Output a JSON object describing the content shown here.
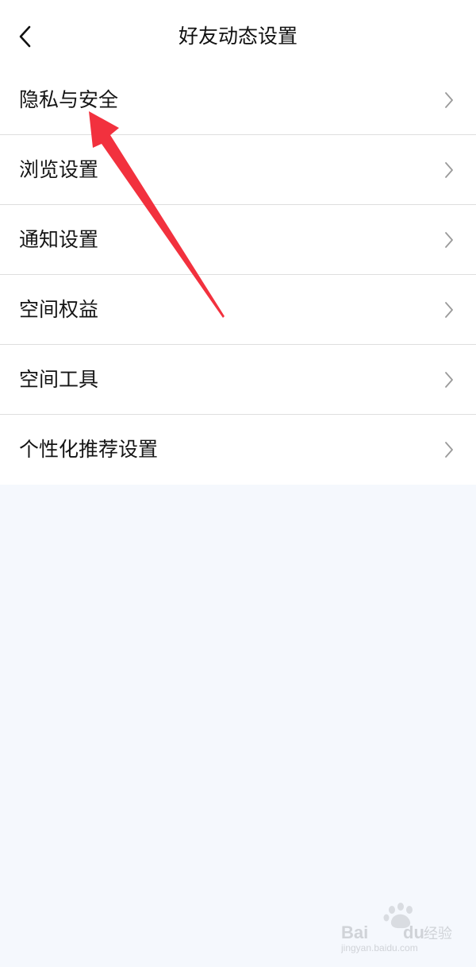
{
  "header": {
    "title": "好友动态设置",
    "back_icon": "chevron-left-icon"
  },
  "menu": {
    "items": [
      {
        "label": "隐私与安全",
        "icon": "chevron-right-icon"
      },
      {
        "label": "浏览设置",
        "icon": "chevron-right-icon"
      },
      {
        "label": "通知设置",
        "icon": "chevron-right-icon"
      },
      {
        "label": "空间权益",
        "icon": "chevron-right-icon"
      },
      {
        "label": "空间工具",
        "icon": "chevron-right-icon"
      },
      {
        "label": "个性化推荐设置",
        "icon": "chevron-right-icon"
      }
    ]
  },
  "annotation": {
    "color": "#f2313e"
  },
  "watermark": {
    "brand_text": "Bai du 经验",
    "url_text": "jingyan.baidu.com"
  },
  "colors": {
    "background": "#f5f8fd",
    "surface": "#ffffff",
    "divider": "#dedede",
    "text": "#151515",
    "chevron": "#9a9a9a"
  }
}
